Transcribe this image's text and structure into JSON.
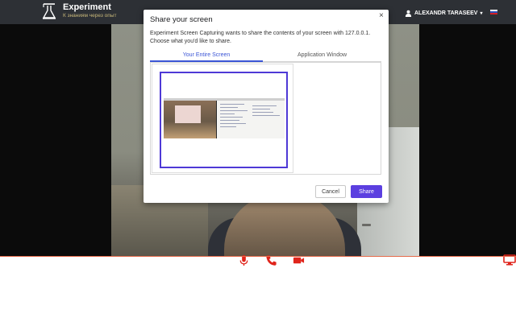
{
  "header": {
    "brand": "Experiment",
    "tagline": "К знаниям через опыт",
    "user_name": "ALEXANDR TARASEEV",
    "user_icon": "user-icon",
    "logo_icon": "flask-icon",
    "language_icon": "russian-flag-icon",
    "nav_bg": "#2d3035"
  },
  "dialog": {
    "title": "Share your screen",
    "close_label": "×",
    "description": "Experiment Screen Capturing wants to share the contents of your screen with 127.0.0.1. Choose what you'd like to share.",
    "tabs": [
      {
        "label": "Your Entire Screen",
        "active": true
      },
      {
        "label": "Application Window",
        "active": false
      }
    ],
    "cancel_label": "Cancel",
    "share_label": "Share",
    "accent_color": "#5b3fe0"
  },
  "call_controls": [
    {
      "icon": "microphone-icon"
    },
    {
      "icon": "phone-icon"
    },
    {
      "icon": "camera-icon"
    },
    {
      "icon": "screen-share-icon"
    }
  ],
  "controls_color": "#e0241b"
}
